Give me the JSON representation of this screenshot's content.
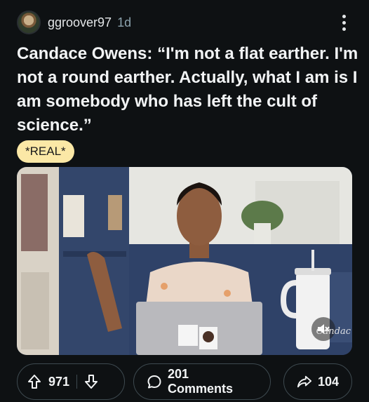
{
  "post": {
    "username": "ggroover97",
    "age": "1d",
    "title": "Candace Owens: “I'm not a flat earther. I'm not a round earther. Actually, what I am is I am somebody who has left the cult of science.”",
    "flair": "*REAL*"
  },
  "media": {
    "watermark": "Candac"
  },
  "actions": {
    "upvotes": "971",
    "comments": "201 Comments",
    "shares": "104"
  },
  "colors": {
    "background": "#0e1113",
    "flair_bg": "#fbe8a6",
    "pill_border": "#3e4a50",
    "meta_text": "#8ba2ad"
  },
  "icons": [
    "more-vertical-icon",
    "upvote-icon",
    "downvote-icon",
    "comment-icon",
    "share-icon",
    "mute-icon"
  ]
}
